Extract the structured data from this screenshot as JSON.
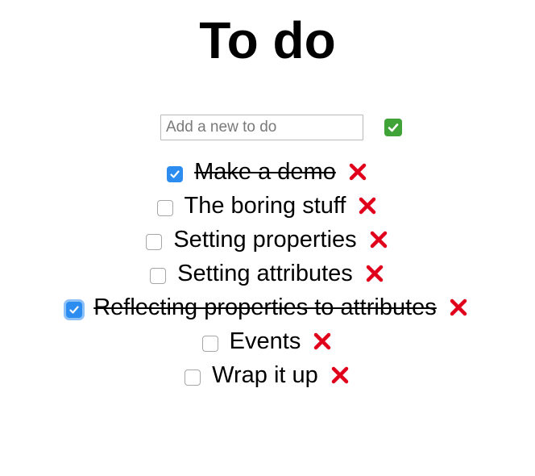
{
  "header": {
    "title": "To do"
  },
  "add": {
    "placeholder": "Add a new to do",
    "button_icon": "check-mark-button-icon"
  },
  "todos": [
    {
      "text": "Make a demo",
      "done": true
    },
    {
      "text": "The boring stuff",
      "done": false
    },
    {
      "text": "Setting properties",
      "done": false
    },
    {
      "text": "Setting attributes",
      "done": false
    },
    {
      "text": "Reflecting properties to attributes",
      "done": true
    },
    {
      "text": "Events",
      "done": false
    },
    {
      "text": "Wrap it up",
      "done": false
    }
  ],
  "colors": {
    "checkbox_checked": "#2d8cf0",
    "delete": "#e0001b",
    "add_button": "#3fa338"
  }
}
